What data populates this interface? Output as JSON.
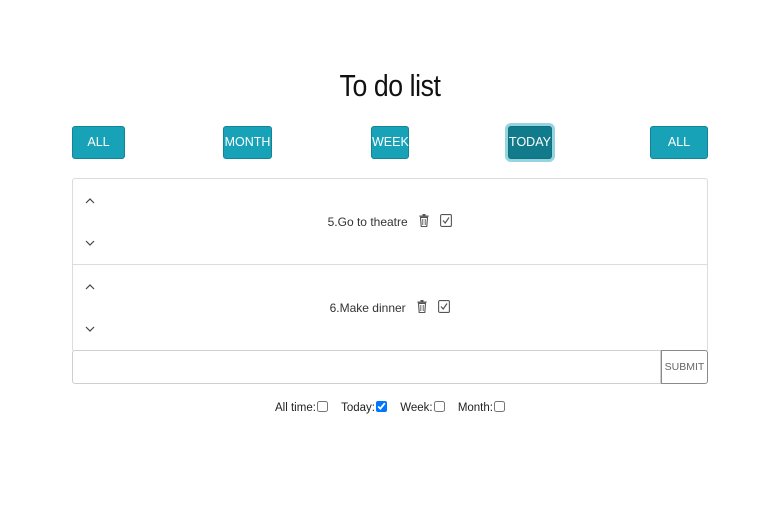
{
  "title": "To do list",
  "filters": [
    {
      "label": "ALL TIME",
      "active": false
    },
    {
      "label": "MONTH",
      "active": false
    },
    {
      "label": "WEEK",
      "active": false
    },
    {
      "label": "TODAY",
      "active": true
    },
    {
      "label": "ALL TASKS",
      "active": false
    }
  ],
  "tasks": [
    {
      "text": "5.Go to theatre",
      "up_icon": "chevron-up-icon",
      "down_icon": "chevron-down-icon",
      "delete_icon": "trash-icon",
      "done_icon": "check-square-icon"
    },
    {
      "text": "6.Make dinner",
      "up_icon": "chevron-up-icon",
      "down_icon": "chevron-down-icon",
      "delete_icon": "trash-icon",
      "done_icon": "check-square-icon"
    }
  ],
  "new_task": {
    "value": "",
    "submit_label": "SUBMIT"
  },
  "period_checks": [
    {
      "label": "All time:",
      "checked": false
    },
    {
      "label": "Today:",
      "checked": true
    },
    {
      "label": "Week:",
      "checked": false
    },
    {
      "label": "Month:",
      "checked": false
    }
  ],
  "colors": {
    "accent": "#17a2b8",
    "accent_active": "#117a8b",
    "checkbox_checked": "#0d6efd"
  }
}
